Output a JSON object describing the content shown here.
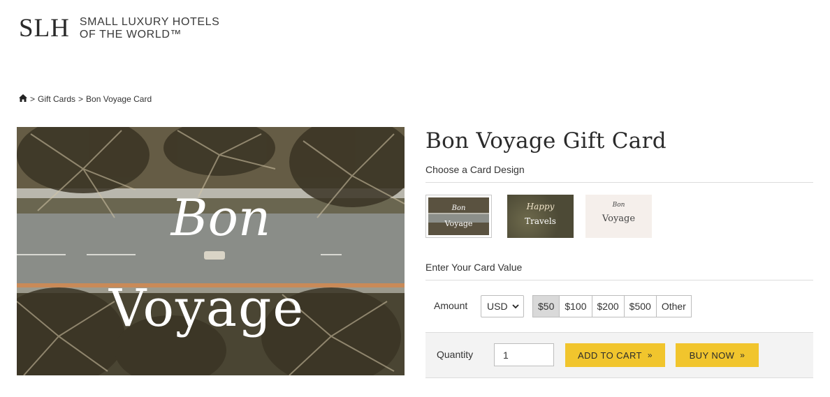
{
  "header": {
    "logo_mark": "SLH",
    "logo_line1": "SMALL LUXURY HOTELS",
    "logo_line2": "OF THE WORLD™"
  },
  "breadcrumb": {
    "home_icon": "home-icon",
    "items": [
      "Gift Cards",
      "Bon Voyage Card"
    ],
    "separator": ">"
  },
  "hero": {
    "script_text": "Bon",
    "main_text": "Voyage"
  },
  "product": {
    "title": "Bon Voyage Gift Card",
    "design_label": "Choose a Card Design",
    "designs": [
      {
        "line1": "Bon",
        "line2": "Voyage"
      },
      {
        "line1": "Happy",
        "line2": "Travels"
      },
      {
        "line1": "Bon",
        "line2": "Voyage"
      }
    ],
    "value_label": "Enter Your Card Value",
    "amount_label": "Amount",
    "currency": "USD",
    "amounts": [
      "$50",
      "$100",
      "$200",
      "$500",
      "Other"
    ],
    "selected_amount": "$50",
    "quantity_label": "Quantity",
    "quantity_value": "1",
    "add_to_cart": "ADD TO CART",
    "buy_now": "BUY NOW",
    "button_arrow": "»"
  },
  "colors": {
    "accent_yellow": "#f1c52d",
    "selected_amount_bg": "#d9d9d9",
    "cart_bar_bg": "#f3f3f3"
  }
}
